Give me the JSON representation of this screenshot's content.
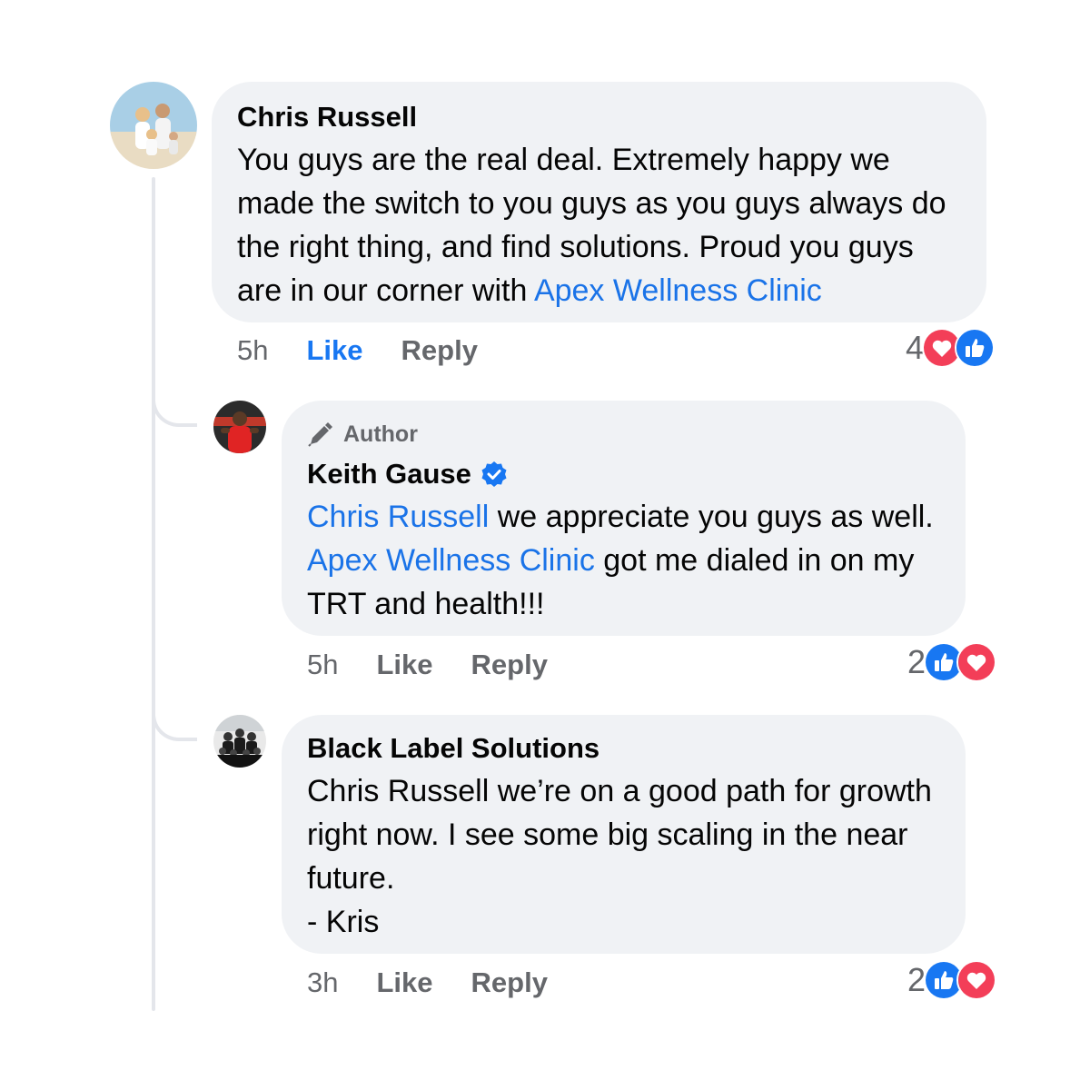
{
  "comments": [
    {
      "author": "Chris Russell",
      "body_parts": [
        "You guys are the real deal. Extremely happy we made the switch to you guys as you guys always do the right thing, and find solutions. Proud you guys are in our corner with ",
        "Apex Wellness Clinic"
      ],
      "time": "5h",
      "like_label": "Like",
      "reply_label": "Reply",
      "reaction_count": "4",
      "reactions": [
        "love-icon",
        "like-icon"
      ],
      "like_active": true,
      "colors": {
        "mention": "#1a73e8",
        "like_active": "#1877f2"
      }
    },
    {
      "badge": "Author",
      "author": "Keith Gause",
      "verified": true,
      "body_parts": [
        "Chris Russell",
        " we appreciate you guys as well. ",
        "Apex Wellness Clinic",
        " got me dialed in on my TRT and health!!!"
      ],
      "time": "5h",
      "like_label": "Like",
      "reply_label": "Reply",
      "reaction_count": "2",
      "reactions": [
        "like-icon",
        "love-icon"
      ]
    },
    {
      "author": "Black Label Solutions",
      "body_lines": [
        "Chris Russell we’re on a good path for growth right now. I see some big scaling in the near future.",
        "- Kris"
      ],
      "time": "3h",
      "like_label": "Like",
      "reply_label": "Reply",
      "reaction_count": "2",
      "reactions": [
        "like-icon",
        "love-icon"
      ]
    }
  ]
}
